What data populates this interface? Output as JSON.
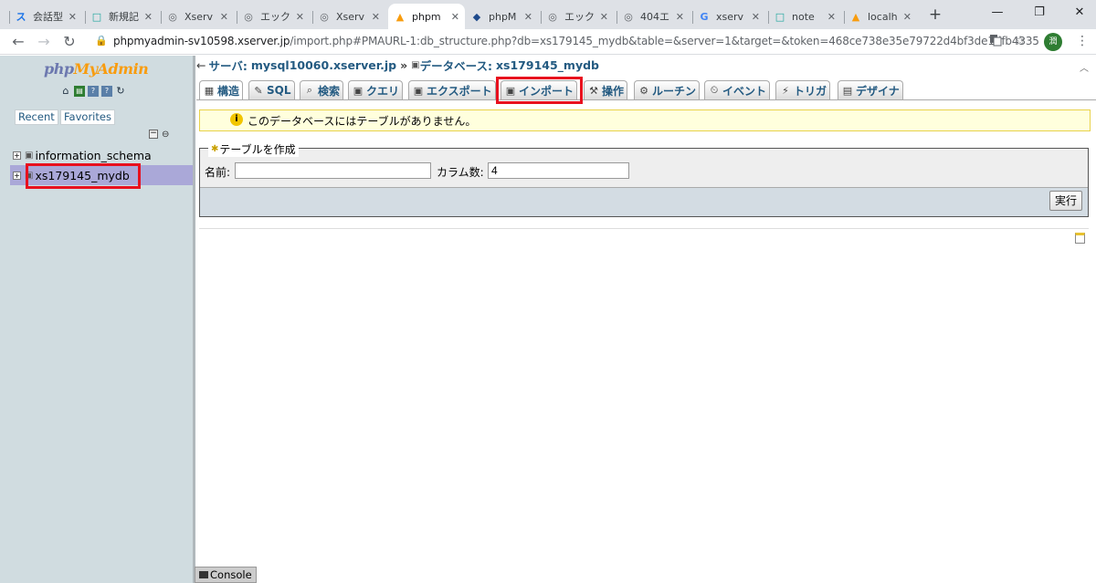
{
  "browser": {
    "tabs": [
      {
        "icon": "ス",
        "icon_color": "#1a73e8",
        "title": "会話型"
      },
      {
        "icon": "□",
        "icon_color": "#1aa59c",
        "title": "新規記"
      },
      {
        "icon": "◎",
        "icon_color": "#5f6368",
        "title": "Xserv"
      },
      {
        "icon": "◎",
        "icon_color": "#5f6368",
        "title": "エック"
      },
      {
        "icon": "◎",
        "icon_color": "#5f6368",
        "title": "Xserv"
      },
      {
        "icon": "▲",
        "icon_color": "#f89c0e",
        "title": "phpm"
      },
      {
        "icon": "◆",
        "icon_color": "#1e4a8c",
        "title": "phpM"
      },
      {
        "icon": "◎",
        "icon_color": "#5f6368",
        "title": "エック"
      },
      {
        "icon": "◎",
        "icon_color": "#5f6368",
        "title": "404エ"
      },
      {
        "icon": "G",
        "icon_color": "#4285f4",
        "title": "xserv"
      },
      {
        "icon": "□",
        "icon_color": "#1aa59c",
        "title": "note"
      },
      {
        "icon": "▲",
        "icon_color": "#f89c0e",
        "title": "localh"
      }
    ],
    "active_tab_index": 5,
    "close_glyph": "✕",
    "new_tab": "+",
    "window_controls": {
      "minimize": "—",
      "restore": "❐",
      "close": "✕"
    },
    "nav": {
      "back": "←",
      "forward": "→",
      "reload": "↻"
    },
    "lock": "🔒",
    "url_host": "phpmyadmin-sv10598.xserver.jp",
    "url_path": "/import.php#PMAURL-1:db_structure.php?db=xs179145_mydb&table=&server=1&target=&token=468ce738e35e79722d4bf3de1dfb4335",
    "translate_icon": "translate-icon",
    "star": "☆",
    "profile": "潤",
    "menu": "⋮"
  },
  "nav_panel": {
    "logo": {
      "php": "php",
      "my": "My",
      "admin": "Admin"
    },
    "icons": [
      "home-icon",
      "sql-icon",
      "docs-icon",
      "help-icon",
      "reload-icon"
    ],
    "recent_label": "Recent",
    "favorites_label": "Favorites",
    "collapse": "−",
    "link_icon": "⊖",
    "databases": [
      {
        "name": "information_schema"
      },
      {
        "name": "xs179145_mydb"
      }
    ]
  },
  "main": {
    "breadcrumb": {
      "server_label": "サーバ:",
      "server": "mysql10060.xserver.jp",
      "sep": "»",
      "db_label": "データベース:",
      "db": "xs179145_mydb"
    },
    "tabs": [
      {
        "icon": "▦",
        "label": "構造"
      },
      {
        "icon": "✎",
        "label": "SQL"
      },
      {
        "icon": "⌕",
        "label": "検索"
      },
      {
        "icon": "▣",
        "label": "クエリ"
      },
      {
        "icon": "▣",
        "label": "エクスポート"
      },
      {
        "icon": "▣",
        "label": "インポート"
      },
      {
        "icon": "⚒",
        "label": "操作"
      },
      {
        "icon": "⚙",
        "label": "ルーチン"
      },
      {
        "icon": "⏲",
        "label": "イベント"
      },
      {
        "icon": "⚡",
        "label": "トリガ"
      },
      {
        "icon": "▤",
        "label": "デザイナ"
      }
    ],
    "notice": "このデータベースにはテーブルがありません。",
    "create_table": {
      "legend": "テーブルを作成",
      "name_label": "名前:",
      "name_value": "",
      "columns_label": "カラム数:",
      "columns_value": "4",
      "go_button": "実行"
    },
    "console_label": "Console"
  },
  "colors": {
    "highlight_box": "#e8101e",
    "link": "#235a81",
    "nav_bg": "#d0dce0",
    "selected_db_bg": "#aaa8d8"
  }
}
